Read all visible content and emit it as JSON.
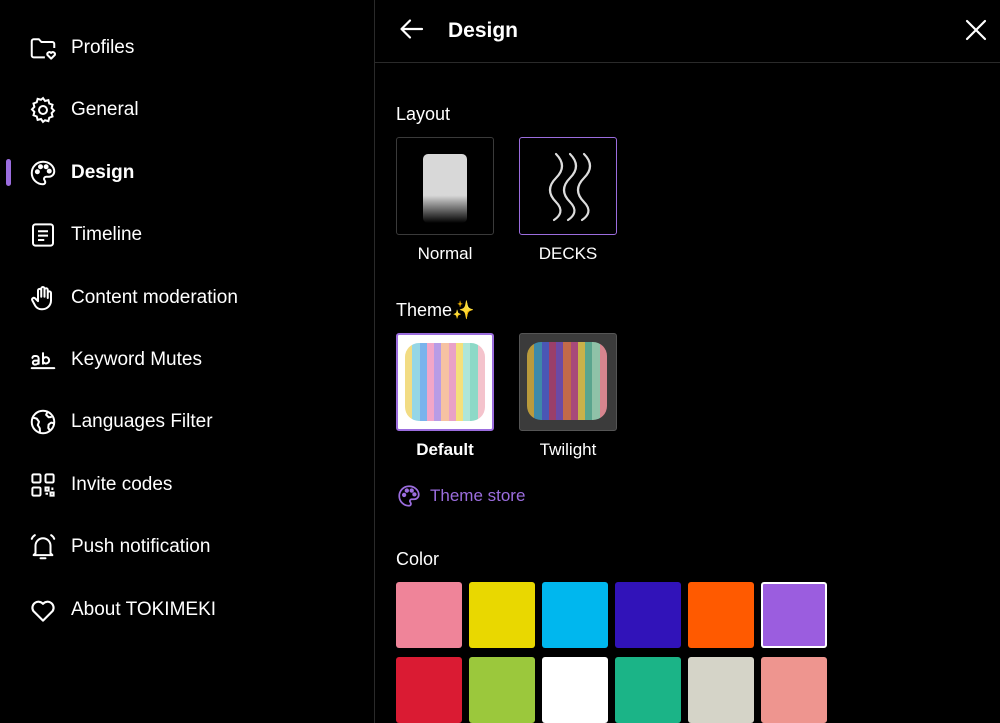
{
  "sidebar": {
    "items": [
      {
        "label": "Profiles",
        "icon": "folder-heart-icon"
      },
      {
        "label": "General",
        "icon": "gear-icon"
      },
      {
        "label": "Design",
        "icon": "palette-icon",
        "active": true
      },
      {
        "label": "Timeline",
        "icon": "document-lines-icon"
      },
      {
        "label": "Content moderation",
        "icon": "hand-icon"
      },
      {
        "label": "Keyword Mutes",
        "icon": "ab-text-icon"
      },
      {
        "label": "Languages Filter",
        "icon": "globe-icon"
      },
      {
        "label": "Invite codes",
        "icon": "qr-code-icon"
      },
      {
        "label": "Push notification",
        "icon": "bell-icon"
      },
      {
        "label": "About TOKIMEKI",
        "icon": "heart-icon"
      }
    ]
  },
  "header": {
    "title": "Design",
    "back_icon": "arrow-left-icon",
    "close_icon": "close-icon"
  },
  "layout": {
    "label": "Layout",
    "options": [
      {
        "label": "Normal"
      },
      {
        "label": "DECKS",
        "selected": true
      }
    ]
  },
  "theme": {
    "label": "Theme✨",
    "options": [
      {
        "label": "Default",
        "selected": true
      },
      {
        "label": "Twilight"
      }
    ],
    "store_label": "Theme store"
  },
  "color": {
    "label": "Color",
    "swatches": [
      "#ef8499",
      "#e9d800",
      "#00b7ee",
      "#3113b9",
      "#ff5a00",
      "#9b5ddf",
      "#da1b33",
      "#9bc83c",
      "#ffffff",
      "#1bb487",
      "#d5d4c8",
      "#ee958f"
    ],
    "selected_index": 5
  },
  "accent": "#9b6dde"
}
